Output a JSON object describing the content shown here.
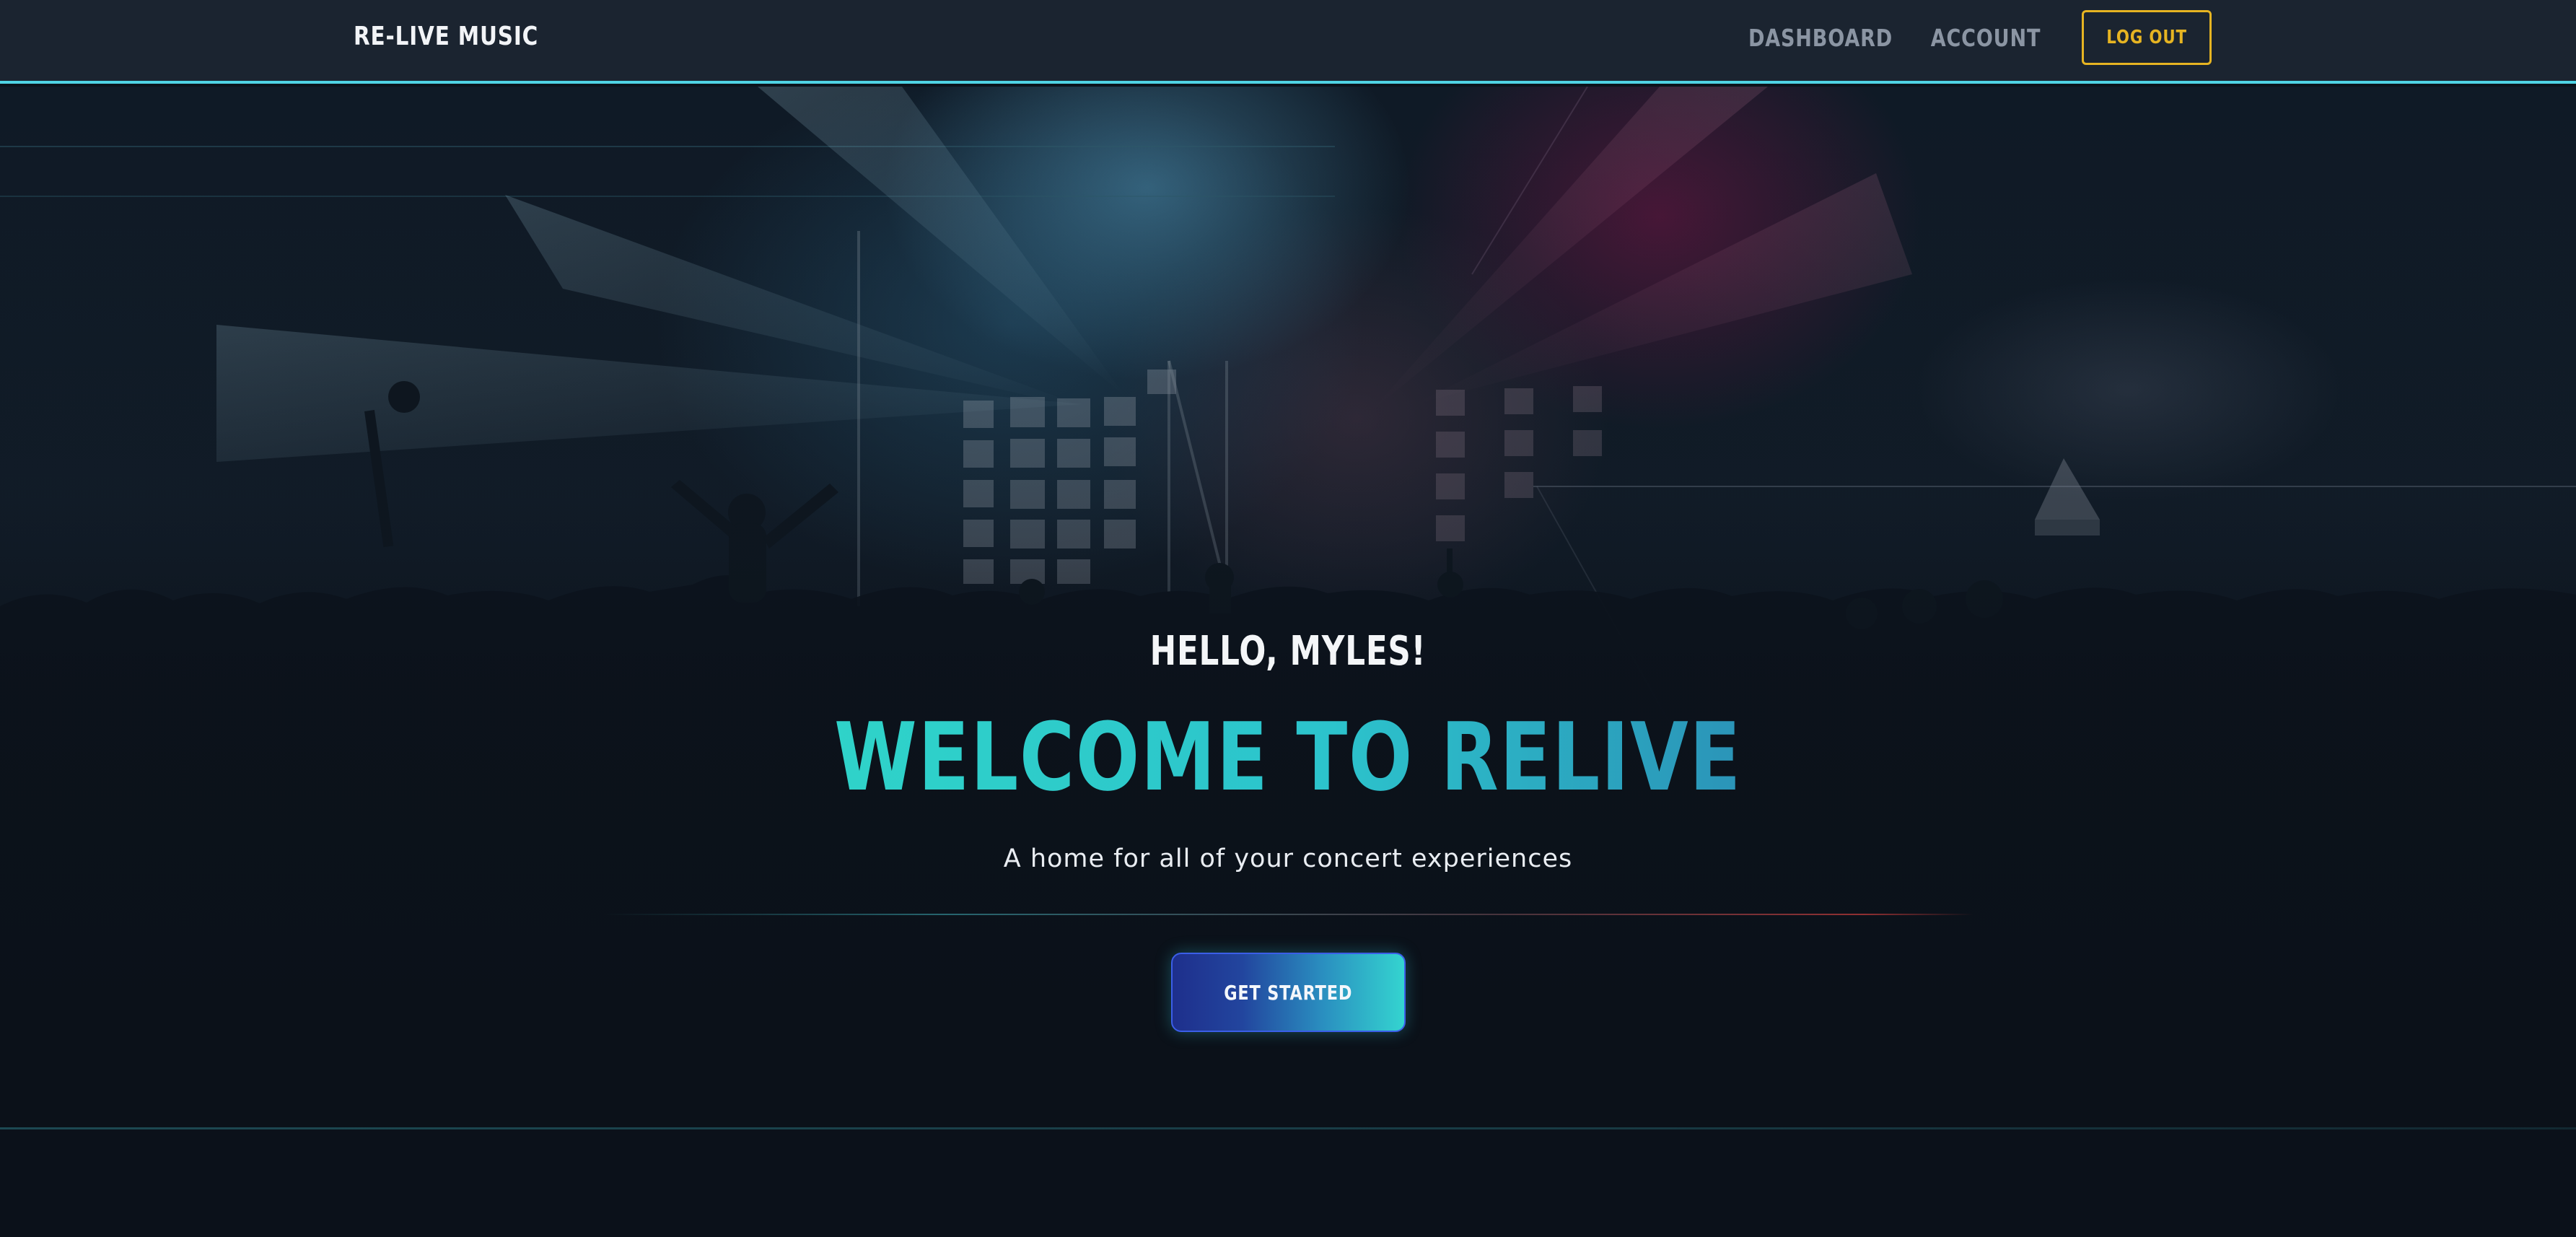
{
  "navbar": {
    "brand": "RE-LIVE MUSIC",
    "links": [
      {
        "label": "DASHBOARD"
      },
      {
        "label": "ACCOUNT"
      }
    ],
    "logout_label": "LOG OUT"
  },
  "hero": {
    "greeting": "HELLO, MYLES!",
    "headline": "WELCOME TO RELIVE",
    "tagline": "A home for all of your concert experiences",
    "cta_label": "GET STARTED"
  },
  "colors": {
    "navbar_bg": "#1b2430",
    "nav_accent_line": "#4fd3e4",
    "logout_accent": "#e6b422",
    "headline_gradient_start": "#2fd3c9",
    "headline_gradient_end": "#2b94b8",
    "cta_gradient_start": "#1e2f8c",
    "cta_gradient_end": "#34d4d0",
    "page_bg": "#0b111a"
  }
}
